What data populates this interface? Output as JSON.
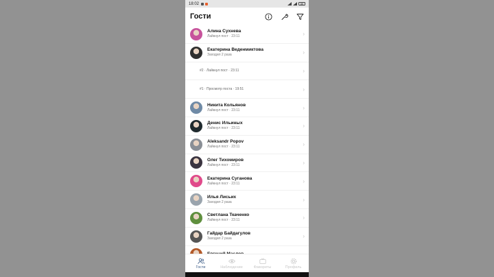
{
  "status": {
    "time": "18:02",
    "battery": "85"
  },
  "header": {
    "title": "Гости"
  },
  "rows": [
    {
      "type": "user",
      "name": "Алина Сухнева",
      "sub": "Лайкнул пост · 23:11",
      "color": "#c7539c"
    },
    {
      "type": "user",
      "name": "Екатерина Веденмиктова",
      "sub": "Заходил 2 раза",
      "color": "#2f2f2f"
    },
    {
      "type": "visit",
      "sub": "#2 · Лайкнул пост · 23:11"
    },
    {
      "type": "visit",
      "sub": "#1 · Просмотр поста · 19:51"
    },
    {
      "type": "user",
      "name": "Никита Кольянов",
      "sub": "Лайкнул пост · 23:11",
      "color": "#6f8aa6"
    },
    {
      "type": "user",
      "name": "Денис Ильиных",
      "sub": "Лайкнул пост · 23:11",
      "color": "#1f2a2e"
    },
    {
      "type": "user",
      "name": "Aleksandr Popov",
      "sub": "Лайкнул пост · 23:11",
      "color": "#8a8f96"
    },
    {
      "type": "user",
      "name": "Олег Тихомиров",
      "sub": "Лайкнул пост · 23:11",
      "color": "#3a3440"
    },
    {
      "type": "user",
      "name": "Екатерина Суганова",
      "sub": "Лайкнул пост · 23:11",
      "color": "#e04a8b"
    },
    {
      "type": "user",
      "name": "Илья Лисьих",
      "sub": "Заходил 2 раза",
      "color": "#9aa4ad"
    },
    {
      "type": "user",
      "name": "Светлана Ткаченко",
      "sub": "Лайкнул пост · 23:11",
      "color": "#5f8f3e"
    },
    {
      "type": "user",
      "name": "Гайдар Байдагулов",
      "sub": "Заходил 2 раза",
      "color": "#555555"
    },
    {
      "type": "user",
      "name": "Евгений Маслов",
      "sub": "",
      "color": "#b35a2a"
    }
  ],
  "tabs": [
    {
      "label": "Гости",
      "icon": "people-icon",
      "active": true
    },
    {
      "label": "Наблюдение",
      "icon": "eye-icon",
      "active": false
    },
    {
      "label": "Фавориты",
      "icon": "tv-icon",
      "active": false
    },
    {
      "label": "Профиль",
      "icon": "gear-icon",
      "active": false
    }
  ]
}
